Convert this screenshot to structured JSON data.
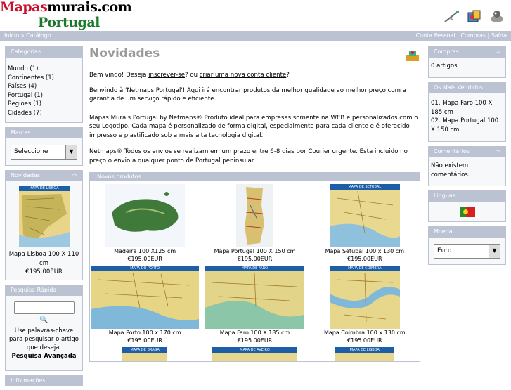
{
  "header": {
    "logo_red": "Mapas",
    "logo_black": "murais.com",
    "logo_green": "Portugal"
  },
  "nav": {
    "breadcrumb": "Início » Catálogo",
    "right_links": "Conta Pessoal | Compras | Saída"
  },
  "categorias": {
    "title": "Categorias",
    "items": [
      "Mundo (1)",
      "Continentes (1)",
      "Países (4)",
      "Portugal (1)",
      "Regioes (1)",
      "Cidades (7)"
    ]
  },
  "marcas": {
    "title": "Marcas",
    "select_value": "Seleccione"
  },
  "novidades_box": {
    "title": "Novidades",
    "product": "Mapa Lisboa 100 X 110 cm",
    "price": "€195.00EUR",
    "band": "MAPA DE LISBOA"
  },
  "pesquisa": {
    "title": "Pesquisa Rápida",
    "help": "Use palavras-chave para pesquisar o artigo que deseja.",
    "advanced": "Pesquisa Avançada"
  },
  "informacoes": {
    "title": "Informações"
  },
  "main": {
    "title": "Novidades",
    "welcome_pre": "Bem vindo! Deseja ",
    "welcome_link1": "inscrever-se",
    "welcome_mid": "? ou ",
    "welcome_link2": "criar uma nova conta cliente",
    "welcome_post": "?",
    "para1": "Benvindo à 'Netmaps Portugal'! Aqui irá encontrar produtos da melhor qualidade ao melhor preço com a garantia de um serviço rápido e eficiente.",
    "para2": "Mapas Murais Portugal by Netmaps® Produto ideal para empresas somente na WEB e personalizados com o seu Logotipo. Cada mapa é personalizado de forma digital, especialmente para cada cliente e é oferecido impresso e plastificado sob a mais alta tecnologia digital.",
    "para3": "Netmaps® Todos os envios se realizam em um prazo entre 6-8 dias por Courier urgente. Esta incluido no preço o envio a qualquer ponto de Portugal peninsular",
    "new_products_title": "Novos produtos"
  },
  "products": [
    {
      "name": "Madeira 100 X125 cm",
      "price": "€195.00EUR",
      "band": ""
    },
    {
      "name": "Mapa Portugal 100 X 150 cm",
      "price": "€195.00EUR",
      "band": ""
    },
    {
      "name": "Mapa Setúbal 100 x 130 cm",
      "price": "€195.00EUR",
      "band": "MAPA DE SETUBAL"
    },
    {
      "name": "Mapa Porto 100 x 170 cm",
      "price": "€195.00EUR",
      "band": "MAPA DO PORTO"
    },
    {
      "name": "Mapa Faro 100 X 185 cm",
      "price": "€195.00EUR",
      "band": "MAPA DE FARO"
    },
    {
      "name": "Mapa Coimbra 100 x 130 cm",
      "price": "€195.00EUR",
      "band": "MAPA DE COIMBRA"
    },
    {
      "name": "",
      "price": "",
      "band": "MAPA DE BRAGA"
    },
    {
      "name": "",
      "price": "",
      "band": "MAPA DE AVEIRO"
    },
    {
      "name": "",
      "price": "",
      "band": "MAPA DE LISBOA"
    }
  ],
  "compras": {
    "title": "Compras",
    "text": "0 artigos"
  },
  "vendidos": {
    "title": "Os Mais Vendidos",
    "items": [
      "01. Mapa Faro 100 X 185 cm",
      "02. Mapa Portugal 100 X 150 cm"
    ]
  },
  "comentarios": {
    "title": "Comentários",
    "text": "Não existem comentários."
  },
  "linguas": {
    "title": "Línguas"
  },
  "moeda": {
    "title": "Moeda",
    "select_value": "Euro"
  },
  "colors": {
    "accent": "#bbc3d3",
    "logo_red": "#c8102e",
    "logo_green": "#1a7a2a"
  }
}
